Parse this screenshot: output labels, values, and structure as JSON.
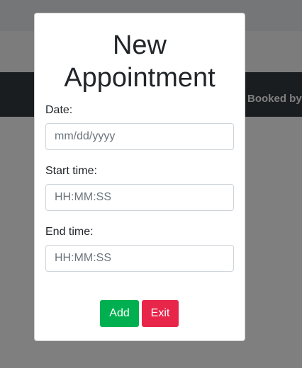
{
  "background": {
    "header_label": "Booked by"
  },
  "modal": {
    "title": "New Appointment",
    "date": {
      "label": "Date:",
      "placeholder": "mm/dd/yyyy"
    },
    "start_time": {
      "label": "Start time:",
      "placeholder": "HH:MM:SS"
    },
    "end_time": {
      "label": "End time:",
      "placeholder": "HH:MM:SS"
    },
    "add_label": "Add",
    "exit_label": "Exit"
  },
  "colors": {
    "add_button": "#00b050",
    "exit_button": "#e8264a",
    "header": "#343a40"
  }
}
